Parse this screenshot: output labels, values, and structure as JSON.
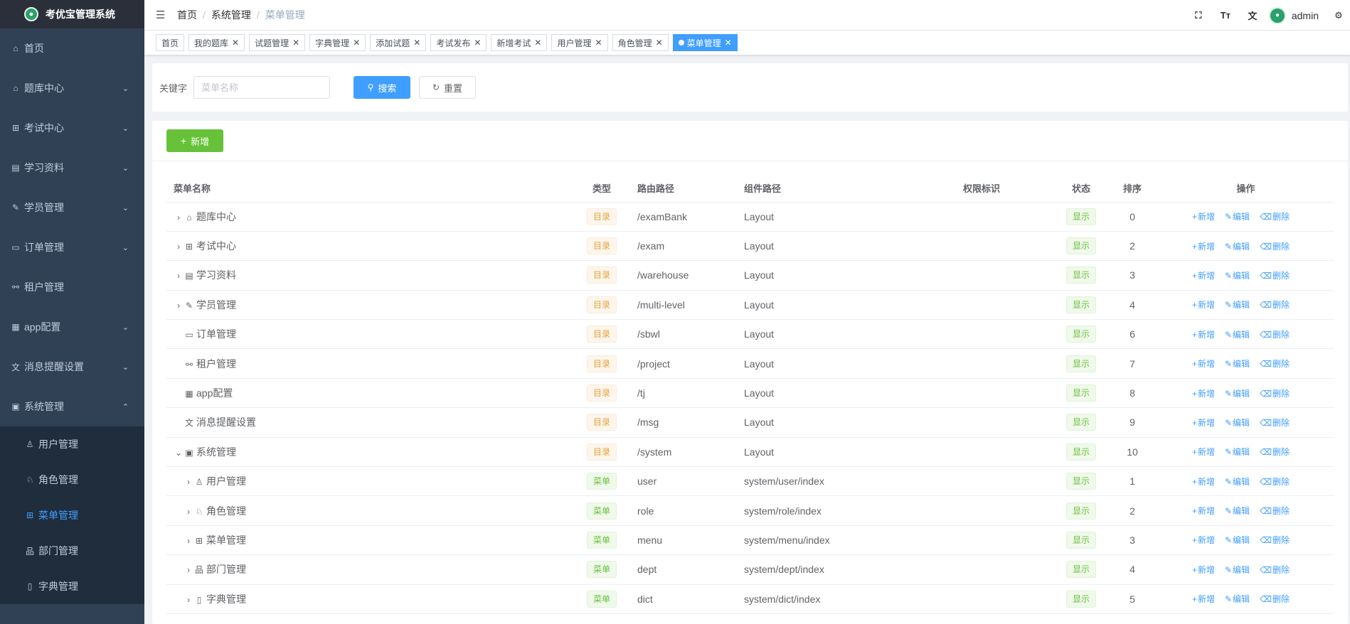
{
  "app": {
    "title": "考优宝管理系统"
  },
  "sidebar": {
    "items": [
      {
        "label": "首页",
        "icon": "home-icon",
        "glyph": "⌂",
        "chevron": ""
      },
      {
        "label": "题库中心",
        "icon": "home-icon",
        "glyph": "⌂",
        "chevron": "⌄"
      },
      {
        "label": "考试中心",
        "icon": "grid-icon",
        "glyph": "⊞",
        "chevron": "⌄"
      },
      {
        "label": "学习资料",
        "icon": "document-icon",
        "glyph": "▤",
        "chevron": "⌄"
      },
      {
        "label": "学员管理",
        "icon": "edit-icon",
        "glyph": "✎",
        "chevron": "⌄"
      },
      {
        "label": "订单管理",
        "icon": "monitor-icon",
        "glyph": "▭",
        "chevron": "⌄"
      },
      {
        "label": "租户管理",
        "icon": "link-icon",
        "glyph": "⚯",
        "chevron": ""
      },
      {
        "label": "app配置",
        "icon": "table-icon",
        "glyph": "▦",
        "chevron": "⌄"
      },
      {
        "label": "消息提醒设置",
        "icon": "language-icon",
        "glyph": "文",
        "chevron": "⌄"
      },
      {
        "label": "系统管理",
        "icon": "system-icon",
        "glyph": "▣",
        "chevron": "⌃"
      }
    ],
    "sub_items": [
      {
        "label": "用户管理",
        "icon": "user-icon",
        "glyph": "♙"
      },
      {
        "label": "角色管理",
        "icon": "peoples-icon",
        "glyph": "♘"
      },
      {
        "label": "菜单管理",
        "icon": "tree-table-icon",
        "glyph": "⊞"
      },
      {
        "label": "部门管理",
        "icon": "tree-icon",
        "glyph": "品"
      },
      {
        "label": "字典管理",
        "icon": "dict-icon",
        "glyph": "▯"
      }
    ]
  },
  "breadcrumb": [
    "首页",
    "系统管理",
    "菜单管理"
  ],
  "navbar": {
    "user": "admin",
    "icons": [
      "⛶",
      "Tт",
      "文"
    ]
  },
  "tags": [
    "首页",
    "我的题库",
    "试题管理",
    "字典管理",
    "添加试题",
    "考试发布",
    "新增考试",
    "用户管理",
    "角色管理",
    "菜单管理"
  ],
  "search": {
    "label": "关键字",
    "placeholder": "菜单名称",
    "search_btn": "搜索",
    "reset_btn": "重置"
  },
  "toolbar": {
    "add_label": "新增"
  },
  "table": {
    "headers": {
      "name": "菜单名称",
      "type": "类型",
      "route": "路由路径",
      "component": "组件路径",
      "perms": "权限标识",
      "status": "状态",
      "order": "排序",
      "ops": "操作"
    },
    "op_labels": {
      "add": "新增",
      "edit": "编辑",
      "delete": "删除"
    },
    "rows": [
      {
        "expand": "›",
        "indent": 0,
        "glyph": "⌂",
        "icon": "home-icon",
        "name": "题库中心",
        "type": "目录",
        "kind": "dir",
        "route": "/examBank",
        "component": "Layout",
        "perms": "",
        "status": "显示",
        "order": "0"
      },
      {
        "expand": "›",
        "indent": 0,
        "glyph": "⊞",
        "icon": "grid-icon",
        "name": "考试中心",
        "type": "目录",
        "kind": "dir",
        "route": "/exam",
        "component": "Layout",
        "perms": "",
        "status": "显示",
        "order": "2"
      },
      {
        "expand": "›",
        "indent": 0,
        "glyph": "▤",
        "icon": "document-icon",
        "name": "学习资料",
        "type": "目录",
        "kind": "dir",
        "route": "/warehouse",
        "component": "Layout",
        "perms": "",
        "status": "显示",
        "order": "3"
      },
      {
        "expand": "›",
        "indent": 0,
        "glyph": "✎",
        "icon": "edit-icon",
        "name": "学员管理",
        "type": "目录",
        "kind": "dir",
        "route": "/multi-level",
        "component": "Layout",
        "perms": "",
        "status": "显示",
        "order": "4"
      },
      {
        "expand": "",
        "indent": 0,
        "glyph": "▭",
        "icon": "monitor-icon",
        "name": "订单管理",
        "type": "目录",
        "kind": "dir",
        "route": "/sbwl",
        "component": "Layout",
        "perms": "",
        "status": "显示",
        "order": "6"
      },
      {
        "expand": "",
        "indent": 0,
        "glyph": "⚯",
        "icon": "link-icon",
        "name": "租户管理",
        "type": "目录",
        "kind": "dir",
        "route": "/project",
        "component": "Layout",
        "perms": "",
        "status": "显示",
        "order": "7"
      },
      {
        "expand": "",
        "indent": 0,
        "glyph": "▦",
        "icon": "table-icon",
        "name": "app配置",
        "type": "目录",
        "kind": "dir",
        "route": "/tj",
        "component": "Layout",
        "perms": "",
        "status": "显示",
        "order": "8"
      },
      {
        "expand": "",
        "indent": 0,
        "glyph": "文",
        "icon": "language-icon",
        "name": "消息提醒设置",
        "type": "目录",
        "kind": "dir",
        "route": "/msg",
        "component": "Layout",
        "perms": "",
        "status": "显示",
        "order": "9"
      },
      {
        "expand": "⌄",
        "indent": 0,
        "glyph": "▣",
        "icon": "system-icon",
        "name": "系统管理",
        "type": "目录",
        "kind": "dir",
        "route": "/system",
        "component": "Layout",
        "perms": "",
        "status": "显示",
        "order": "10"
      },
      {
        "expand": "›",
        "indent": 1,
        "glyph": "♙",
        "icon": "user-icon",
        "name": "用户管理",
        "type": "菜单",
        "kind": "menu",
        "route": "user",
        "component": "system/user/index",
        "perms": "",
        "status": "显示",
        "order": "1"
      },
      {
        "expand": "›",
        "indent": 1,
        "glyph": "♘",
        "icon": "peoples-icon",
        "name": "角色管理",
        "type": "菜单",
        "kind": "menu",
        "route": "role",
        "component": "system/role/index",
        "perms": "",
        "status": "显示",
        "order": "2"
      },
      {
        "expand": "›",
        "indent": 1,
        "glyph": "⊞",
        "icon": "tree-table-icon",
        "name": "菜单管理",
        "type": "菜单",
        "kind": "menu",
        "route": "menu",
        "component": "system/menu/index",
        "perms": "",
        "status": "显示",
        "order": "3"
      },
      {
        "expand": "›",
        "indent": 1,
        "glyph": "品",
        "icon": "tree-icon",
        "name": "部门管理",
        "type": "菜单",
        "kind": "menu",
        "route": "dept",
        "component": "system/dept/index",
        "perms": "",
        "status": "显示",
        "order": "4"
      },
      {
        "expand": "›",
        "indent": 1,
        "glyph": "▯",
        "icon": "dict-icon",
        "name": "字典管理",
        "type": "菜单",
        "kind": "menu",
        "route": "dict",
        "component": "system/dict/index",
        "perms": "",
        "status": "显示",
        "order": "5"
      }
    ]
  },
  "colors": {
    "sidebar_bg": "#304156",
    "primary": "#409eff",
    "success": "#67c23a",
    "warning": "#e6a23c"
  }
}
